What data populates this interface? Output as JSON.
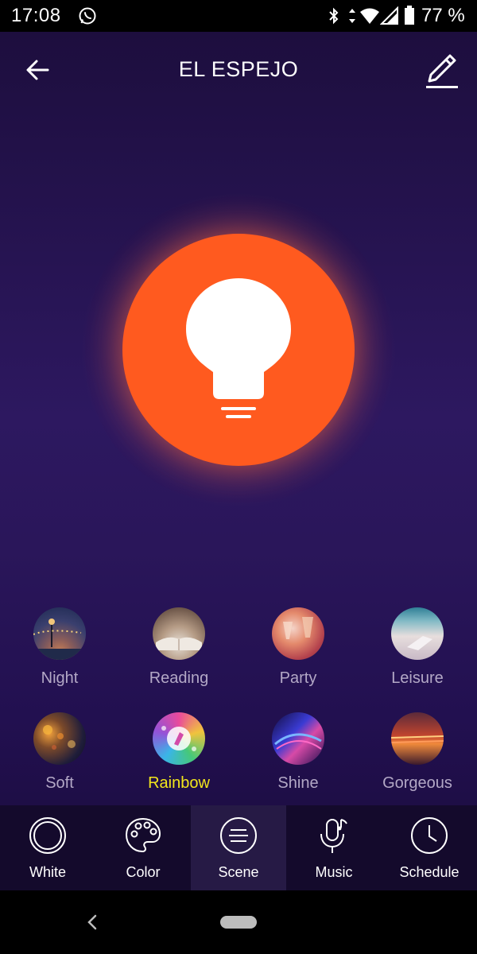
{
  "status_bar": {
    "time": "17:08",
    "battery": "77 %",
    "icons": [
      "whatsapp-icon",
      "bluetooth-icon",
      "data-arrows-icon",
      "wifi-icon",
      "cell-signal-icon",
      "battery-icon"
    ]
  },
  "header": {
    "title": "EL ESPEJO",
    "back_icon": "arrow-left-icon",
    "edit_icon": "pencil-icon"
  },
  "bulb": {
    "color": "#ff5a1f",
    "icon": "bulb-icon"
  },
  "scenes": [
    {
      "label": "Night",
      "active": false
    },
    {
      "label": "Reading",
      "active": false
    },
    {
      "label": "Party",
      "active": false
    },
    {
      "label": "Leisure",
      "active": false
    },
    {
      "label": "Soft",
      "active": false
    },
    {
      "label": "Rainbow",
      "active": true
    },
    {
      "label": "Shine",
      "active": false
    },
    {
      "label": "Gorgeous",
      "active": false
    }
  ],
  "tabs": [
    {
      "label": "White",
      "icon": "white-circle-icon",
      "active": false
    },
    {
      "label": "Color",
      "icon": "palette-icon",
      "active": false
    },
    {
      "label": "Scene",
      "icon": "scene-lines-icon",
      "active": true
    },
    {
      "label": "Music",
      "icon": "microphone-music-icon",
      "active": false
    },
    {
      "label": "Schedule",
      "icon": "clock-icon",
      "active": false
    }
  ],
  "colors": {
    "accent_active_scene": "#f3e61c",
    "inactive_text": "#b3a8c6",
    "background": "#2a165a"
  }
}
